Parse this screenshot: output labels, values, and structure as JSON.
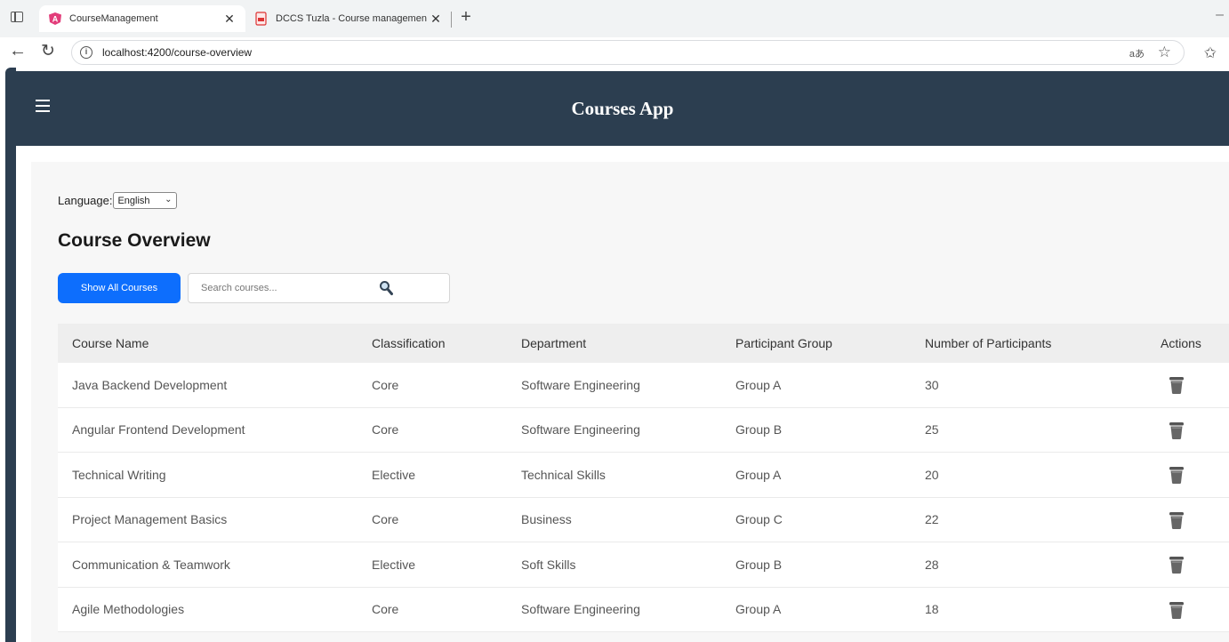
{
  "browser": {
    "tabs": [
      {
        "title": "CourseManagement",
        "active": true
      },
      {
        "title": "DCCS Tuzla - Course managemen",
        "active": false
      }
    ],
    "url": "localhost:4200/course-overview"
  },
  "app": {
    "title": "Courses App"
  },
  "language": {
    "label": "Language:",
    "selected": "English"
  },
  "page_title": "Course Overview",
  "toolbar": {
    "show_all_label": "Show All Courses",
    "search_placeholder": "Search courses..."
  },
  "table": {
    "headers": [
      "Course Name",
      "Classification",
      "Department",
      "Participant Group",
      "Number of Participants",
      "Actions"
    ],
    "rows": [
      {
        "name": "Java Backend Development",
        "classification": "Core",
        "department": "Software Engineering",
        "group": "Group A",
        "participants": "30"
      },
      {
        "name": "Angular Frontend Development",
        "classification": "Core",
        "department": "Software Engineering",
        "group": "Group B",
        "participants": "25"
      },
      {
        "name": "Technical Writing",
        "classification": "Elective",
        "department": "Technical Skills",
        "group": "Group A",
        "participants": "20"
      },
      {
        "name": "Project Management Basics",
        "classification": "Core",
        "department": "Business",
        "group": "Group C",
        "participants": "22"
      },
      {
        "name": "Communication & Teamwork",
        "classification": "Elective",
        "department": "Soft Skills",
        "group": "Group B",
        "participants": "28"
      },
      {
        "name": "Agile Methodologies",
        "classification": "Core",
        "department": "Software Engineering",
        "group": "Group A",
        "participants": "18"
      }
    ]
  },
  "colors": {
    "header_bg": "#2c3e50",
    "primary_button": "#0d6efd"
  }
}
